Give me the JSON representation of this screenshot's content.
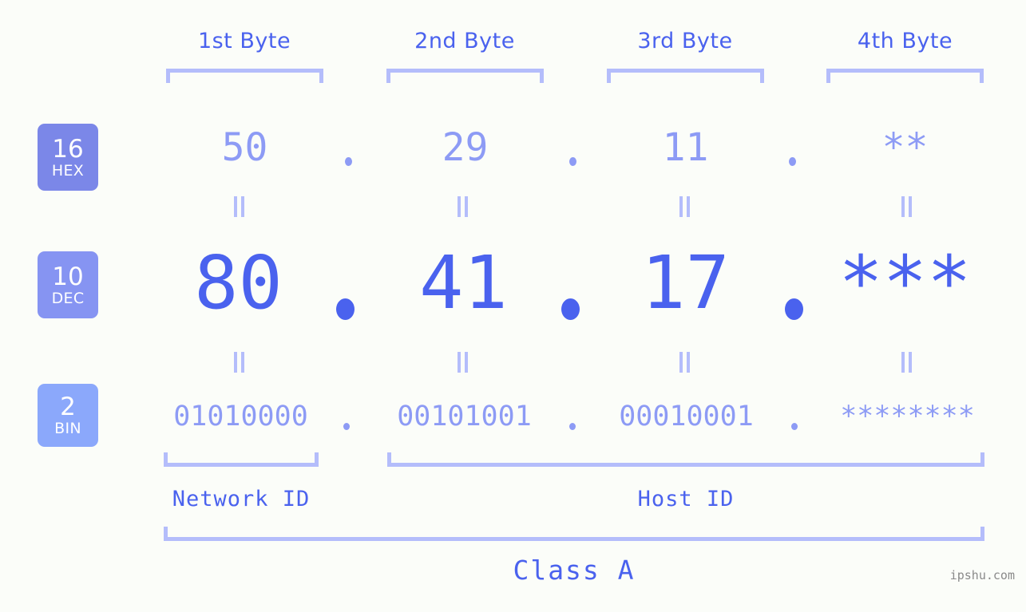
{
  "background_color": "#fbfdf9",
  "accent_color": "#4a62ee",
  "accent_light_color": "#8d9bf5",
  "bracket_color": "#b4bdfb",
  "byte_headers": [
    {
      "label": "1st Byte"
    },
    {
      "label": "2nd Byte"
    },
    {
      "label": "3rd Byte"
    },
    {
      "label": "4th Byte"
    }
  ],
  "rows": {
    "hex": {
      "badge_number": "16",
      "badge_name": "HEX",
      "badge_color": "#7b87e8",
      "values": [
        "50",
        "29",
        "11",
        "**"
      ],
      "separator": "."
    },
    "dec": {
      "badge_number": "10",
      "badge_name": "DEC",
      "badge_color": "#8694f2",
      "values": [
        "80",
        "41",
        "17",
        "***"
      ],
      "separator": "."
    },
    "bin": {
      "badge_number": "2",
      "badge_name": "BIN",
      "badge_color": "#8ba8fb",
      "values": [
        "01010000",
        "00101001",
        "00010001",
        "********"
      ],
      "separator": "."
    }
  },
  "equality_marker": "=",
  "sections": {
    "network_id": "Network ID",
    "host_id": "Host ID"
  },
  "class_label": "Class A",
  "watermark": "ipshu.com"
}
